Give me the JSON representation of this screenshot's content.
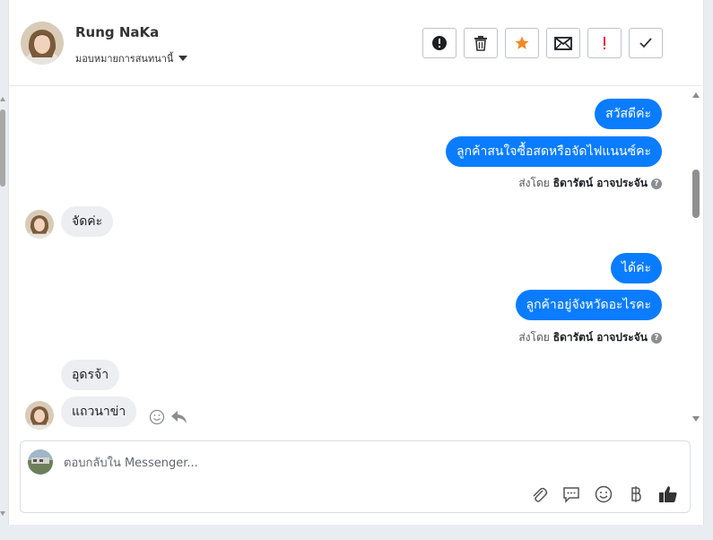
{
  "contact": {
    "name": "Rung NaKa",
    "assign_label": "มอบหมายการสนทนานี้"
  },
  "header_actions": [
    {
      "icon": "alert-circle-icon"
    },
    {
      "icon": "trash-icon"
    },
    {
      "icon": "star-icon",
      "color": "#f08a24"
    },
    {
      "icon": "envelope-icon"
    },
    {
      "icon": "exclamation-icon",
      "color": "#e41e3f"
    },
    {
      "icon": "checkmark-icon"
    }
  ],
  "messages": {
    "m1": "สวัสดีค่ะ",
    "m2": "ลูกค้าสนใจซื้อสดหรือจัดไฟแนนซ์คะ",
    "m3": "จัดค่ะ",
    "m4": "ได้ค่ะ",
    "m5": "ลูกค้าอยู่จังหวัดอะไรคะ",
    "m6": "อุดรจ้า",
    "m7": "แถวนาข่า"
  },
  "sent_by": {
    "prefix": "ส่งโดย",
    "agent": "ธิดารัตน์ อาจประจัน"
  },
  "composer": {
    "placeholder": "ตอบกลับใน Messenger..."
  },
  "colors": {
    "outgoing_bubble": "#0a7cff",
    "incoming_bubble": "#eceef1"
  }
}
